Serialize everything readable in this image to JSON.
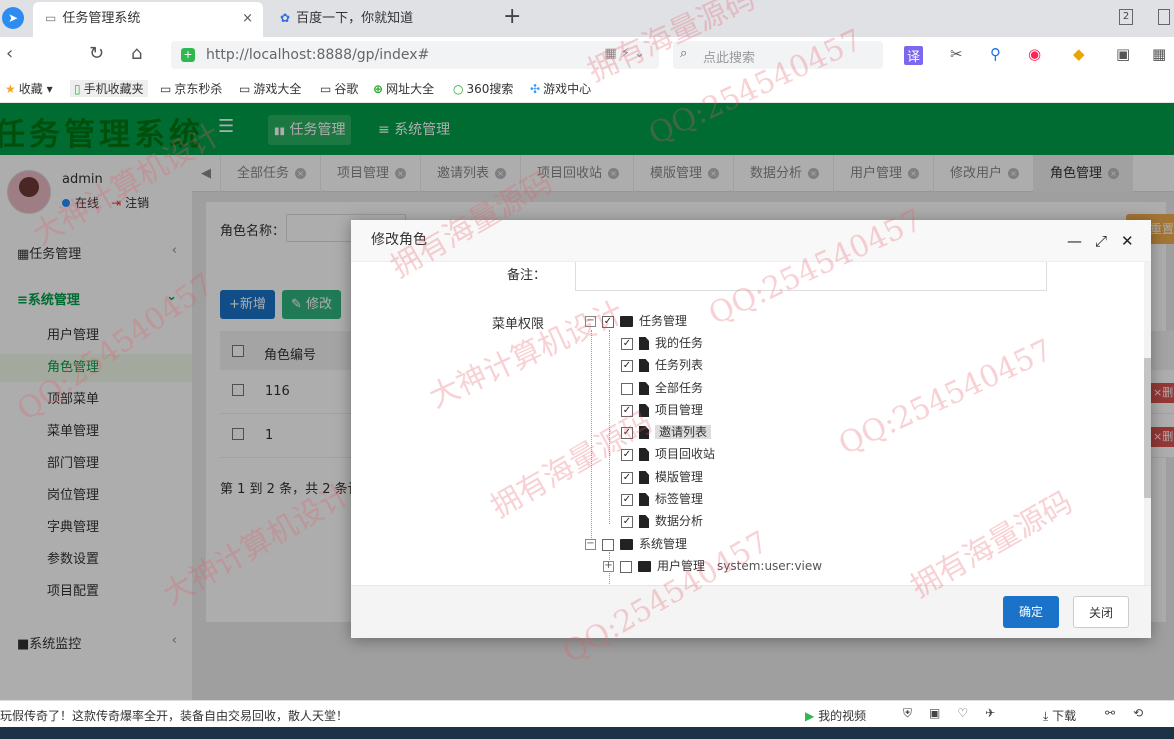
{
  "browser": {
    "tabs": [
      {
        "title": "任务管理系统",
        "close": "×"
      },
      {
        "title": "百度一下，你就知道"
      }
    ],
    "new_tab": "+",
    "window_badge": "2",
    "url": "http://localhost:8888/gp/index#",
    "search_placeholder": "点此搜索"
  },
  "bookmarks": [
    {
      "label": "收藏",
      "icon": "★"
    },
    {
      "label": "手机收藏夹",
      "icon": "▯"
    },
    {
      "label": "京东秒杀",
      "icon": "▭"
    },
    {
      "label": "游戏大全",
      "icon": "▭"
    },
    {
      "label": "谷歌",
      "icon": "▭"
    },
    {
      "label": "网址大全",
      "icon": "⊕"
    },
    {
      "label": "360搜索",
      "icon": "○"
    },
    {
      "label": "游戏中心",
      "icon": "✣"
    }
  ],
  "app": {
    "logo": "任务管理系统",
    "top_nav": [
      {
        "label": "任务管理",
        "icon": "▮▮"
      },
      {
        "label": "系统管理",
        "icon": "≡"
      }
    ]
  },
  "sidebar": {
    "user": "admin",
    "online": "在线",
    "logout": "注销",
    "sections": [
      {
        "label": "任务管理",
        "icon": "▦"
      },
      {
        "label": "系统管理",
        "icon": "≡"
      },
      {
        "label": "系统监控",
        "icon": "■"
      }
    ],
    "items": [
      "用户管理",
      "角色管理",
      "顶部菜单",
      "菜单管理",
      "部门管理",
      "岗位管理",
      "字典管理",
      "参数设置",
      "项目配置"
    ]
  },
  "tabs": [
    "全部任务",
    "项目管理",
    "邀请列表",
    "项目回收站",
    "模版管理",
    "数据分析",
    "用户管理",
    "修改用户",
    "角色管理"
  ],
  "page": {
    "role_name_label": "角色名称：",
    "add_btn": "+新增",
    "edit_btn": "修改",
    "col_role_id": "角色编号",
    "rows": [
      {
        "id": "116"
      },
      {
        "id": "1"
      }
    ],
    "pagination": "第 1 到 2 条，共 2 条记",
    "reset_btn": "重置",
    "del_btn": "×删"
  },
  "modal": {
    "title": "修改角色",
    "remark_label": "备注：",
    "menu_perm_label": "菜单权限",
    "tree": [
      {
        "label": "任务管理",
        "level": 0,
        "checked": true,
        "folder": true,
        "expand": "−"
      },
      {
        "label": "我的任务",
        "level": 1,
        "checked": true
      },
      {
        "label": "任务列表",
        "level": 1,
        "checked": true
      },
      {
        "label": "全部任务",
        "level": 1,
        "checked": false
      },
      {
        "label": "项目管理",
        "level": 1,
        "checked": true
      },
      {
        "label": "邀请列表",
        "level": 1,
        "checked": true,
        "highlight": true
      },
      {
        "label": "项目回收站",
        "level": 1,
        "checked": true
      },
      {
        "label": "模版管理",
        "level": 1,
        "checked": true
      },
      {
        "label": "标签管理",
        "level": 1,
        "checked": true
      },
      {
        "label": "数据分析",
        "level": 1,
        "checked": true
      },
      {
        "label": "系统管理",
        "level": 0,
        "checked": false,
        "folder": true,
        "expand": "−"
      },
      {
        "label": "用户管理",
        "level": 1,
        "checked": false,
        "folder": true,
        "expand": "+",
        "perm": "system:user:view"
      }
    ],
    "ok": "确定",
    "close": "关闭"
  },
  "status_bar": {
    "ad": "玩假传奇了！这款传奇爆率全开，装备自由交易回收，散人天堂！",
    "video": "我的视频",
    "download": "下载"
  },
  "watermarks": [
    "拥有海量源码",
    "QQ:254540457",
    "大神计算机设计",
    "拥有海量源码",
    "QQ:254540457",
    "大神计算机设计",
    "QQ:254540457",
    "拥有海量源码",
    "大神计算机设计",
    "QQ:254540457",
    "拥有海量源码",
    "QQ:254540457"
  ]
}
